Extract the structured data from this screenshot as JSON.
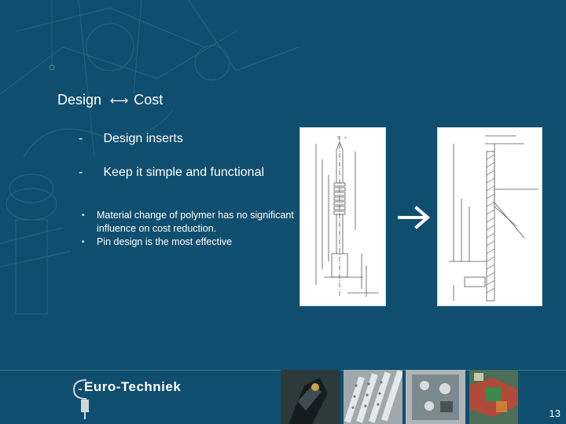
{
  "slide": {
    "title": {
      "left": "Design",
      "arrows": "←→",
      "right": "Cost"
    },
    "dash_items": [
      {
        "mark": "-",
        "text": "Design inserts"
      },
      {
        "mark": "-",
        "text": "Keep it simple and functional"
      }
    ],
    "bullets": [
      {
        "mark": "•",
        "text": "Material change of polymer has no significant influence on cost reduction."
      },
      {
        "mark": "•",
        "text": "Pin design is the most effective"
      }
    ],
    "logo_text": "Euro-Techniek",
    "page_number": "13"
  },
  "colors": {
    "background": "#0f4e6e",
    "text": "#ffffff",
    "drawing_bg": "#ffffff"
  },
  "icons": {
    "arrow": "right-arrow-icon",
    "logo": "euro-techniek-logo"
  }
}
